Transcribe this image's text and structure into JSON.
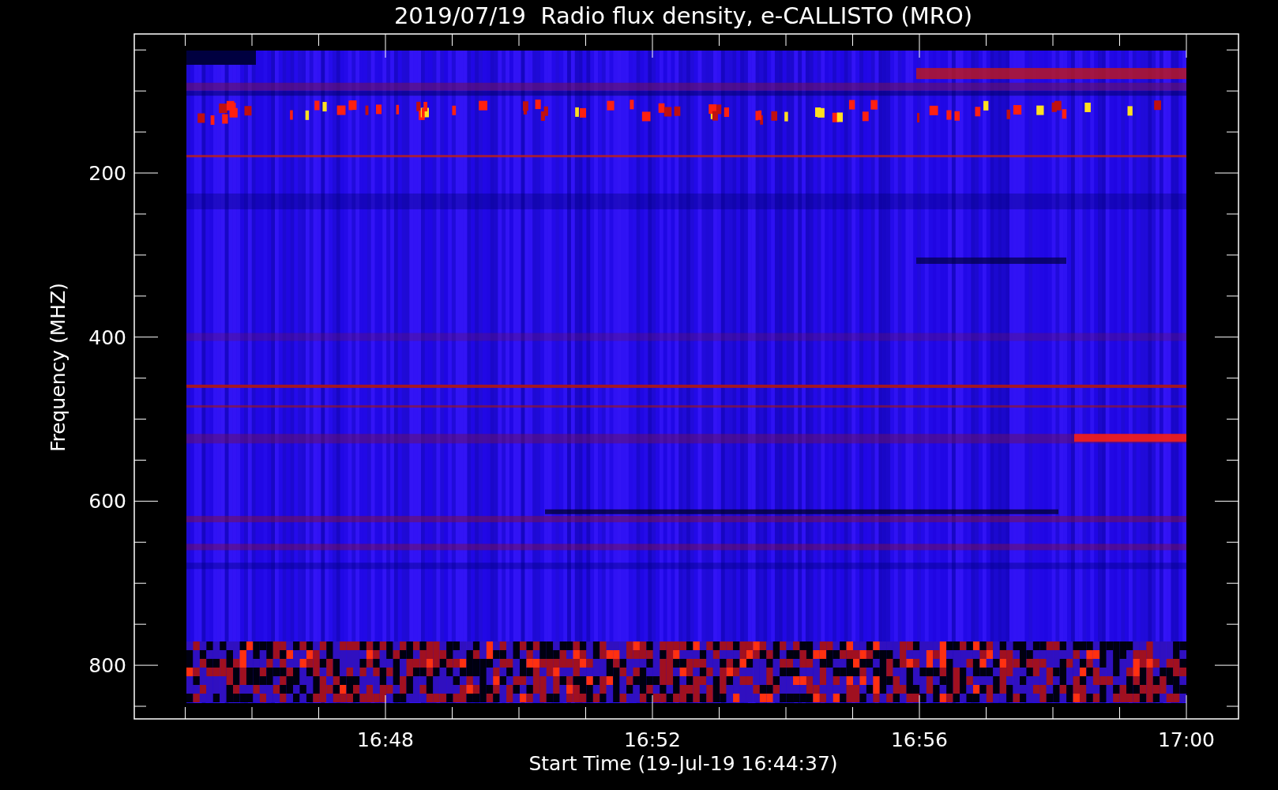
{
  "title": "2019/07/19  Radio flux density, e-CALLISTO (MRO)",
  "chart": {
    "ylabel": "Frequency (MHZ)",
    "xlabel": "Start Time (19-Jul-19 16:44:37)",
    "yticks": [
      "200",
      "400",
      "600",
      "800"
    ],
    "xticks": [
      "16:48",
      "16:52",
      "16:56",
      "17:00"
    ]
  }
}
